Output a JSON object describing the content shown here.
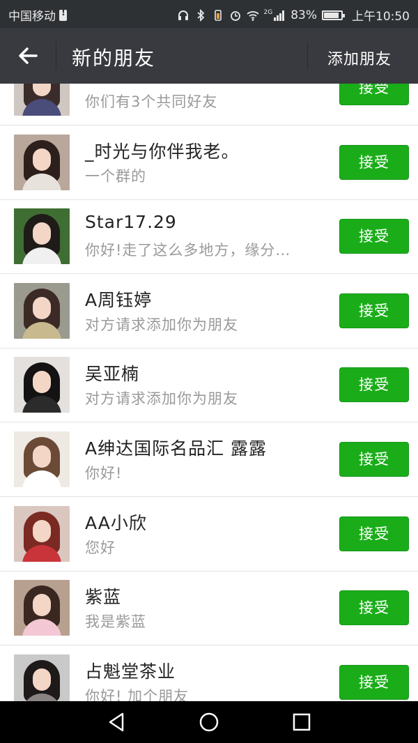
{
  "status_bar": {
    "carrier": "中国移动",
    "network": "2G",
    "battery": "83%",
    "time": "上午10:50",
    "icons": [
      "sim-alert-icon",
      "headphone-icon",
      "bluetooth-icon",
      "vibrate-icon",
      "alarm-icon",
      "wifi-icon",
      "signal-icon",
      "battery-icon"
    ]
  },
  "header": {
    "title": "新的朋友",
    "action_label": "添加朋友",
    "back_icon": "back-arrow-icon"
  },
  "requests": [
    {
      "name": "",
      "message": "你们有3个共同好友",
      "button": "接受",
      "avatar_colors": [
        "#cfc7c2",
        "#3a2c2a",
        "#4a4d7a"
      ]
    },
    {
      "name": "_时光与你伴我老。",
      "message": "一个群的",
      "button": "接受",
      "avatar_colors": [
        "#b9a79c",
        "#2c1f1c",
        "#e8e2dd"
      ]
    },
    {
      "name": "Star17.29",
      "message": "你好!走了这么多地方，缘分…",
      "button": "接受",
      "avatar_colors": [
        "#3f6e33",
        "#1f1b19",
        "#f0f0f0"
      ]
    },
    {
      "name": "A周钰婷",
      "message": "对方请求添加你为朋友",
      "button": "接受",
      "avatar_colors": [
        "#9b9a8f",
        "#3b2a25",
        "#c9b98e"
      ]
    },
    {
      "name": "吴亚楠",
      "message": "对方请求添加你为朋友",
      "button": "接受",
      "avatar_colors": [
        "#e4e0de",
        "#141212",
        "#2b2b2b"
      ]
    },
    {
      "name": "A绅达国际名品汇 露露",
      "message": "你好!",
      "button": "接受",
      "avatar_colors": [
        "#efe9e4",
        "#6b4a36",
        "#ffffff"
      ]
    },
    {
      "name": "AA小欣",
      "message": "您好",
      "button": "接受",
      "avatar_colors": [
        "#d9c7c0",
        "#7a2a22",
        "#c9343b"
      ]
    },
    {
      "name": "紫蓝",
      "message": "我是紫蓝",
      "button": "接受",
      "avatar_colors": [
        "#b8a090",
        "#3a2720",
        "#f3c7d4"
      ]
    },
    {
      "name": "占魁堂茶业",
      "message": "你好! 加个朋友",
      "button": "接受",
      "avatar_colors": [
        "#c9c9c9",
        "#1d1a19",
        "#8a8583"
      ]
    }
  ],
  "nav_bar": {
    "icons": [
      "back-triangle-icon",
      "home-circle-icon",
      "recents-square-icon"
    ]
  },
  "colors": {
    "status_bar": "#2e3134",
    "title_bar": "#393a3f",
    "accept_button": "#1aad19",
    "name_text": "#222222",
    "message_text": "#9a9a9a"
  }
}
